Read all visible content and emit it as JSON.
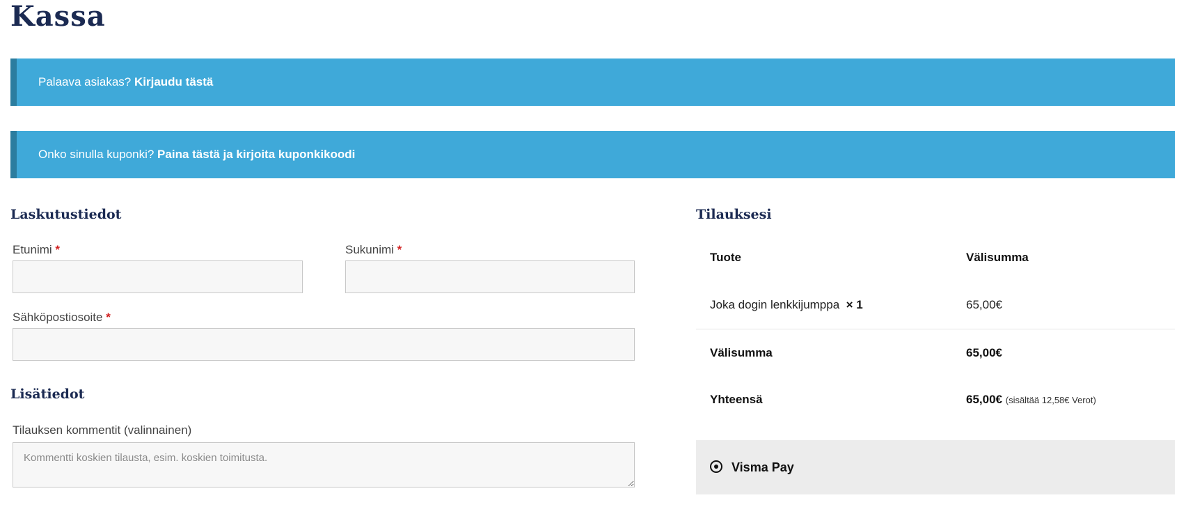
{
  "page": {
    "title": "Kassa"
  },
  "notices": {
    "login": {
      "text": "Palaava asiakas? ",
      "link": "Kirjaudu tästä"
    },
    "coupon": {
      "text": "Onko sinulla kuponki? ",
      "link": "Paina tästä ja kirjoita kuponkikoodi"
    }
  },
  "billing": {
    "heading": "Laskutustiedot",
    "required_mark": "*",
    "first_name": {
      "label": "Etunimi",
      "value": ""
    },
    "last_name": {
      "label": "Sukunimi",
      "value": ""
    },
    "email": {
      "label": "Sähköpostiosoite",
      "value": ""
    }
  },
  "additional": {
    "heading": "Lisätiedot",
    "comments": {
      "label": "Tilauksen kommentit (valinnainen)",
      "placeholder": "Kommentti koskien tilausta, esim. koskien toimitusta.",
      "value": ""
    }
  },
  "order": {
    "heading": "Tilauksesi",
    "headers": {
      "product": "Tuote",
      "subtotal": "Välisumma"
    },
    "items": [
      {
        "name": "Joka dogin lenkkijumppa",
        "qty": "× 1",
        "subtotal": "65,00€"
      }
    ],
    "subtotal": {
      "label": "Välisumma",
      "value": "65,00€"
    },
    "total": {
      "label": "Yhteensä",
      "value": "65,00€",
      "tax_note": "(sisältää 12,58€ Verot)"
    }
  },
  "payment": {
    "method": "Visma Pay",
    "icon": "radio-selected-icon",
    "selected": true
  },
  "colors": {
    "notice_bg": "#3fa9d9",
    "notice_border": "#2b7d9f",
    "heading": "#1b2a52",
    "required": "#d12020",
    "payment_bg": "#ececec"
  }
}
